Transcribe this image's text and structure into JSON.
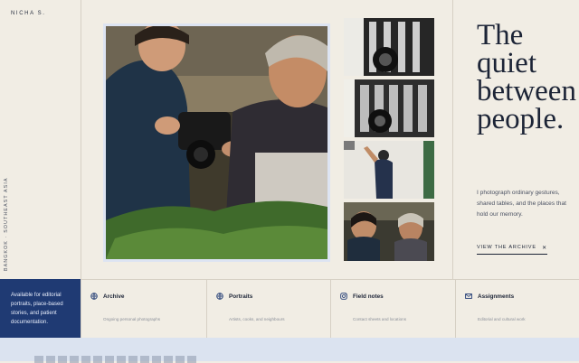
{
  "brand": "NICHA S.",
  "location_vertical": "BANGKOK · SOUTHEAST ASIA",
  "headline": [
    "The",
    "quiet",
    "between",
    "people."
  ],
  "intro": "I photograph ordinary gestures, shared tables, and the places that hold our memory.",
  "cta": {
    "label": "VIEW THE ARCHIVE",
    "icon": "x-icon"
  },
  "availability": "Available for editorial portraits, place-based stories, and patient documentation.",
  "cards": [
    {
      "title": "Archive",
      "desc": "Ongoing personal photographs",
      "icon": "globe-icon"
    },
    {
      "title": "Portraits",
      "desc": "Artists, cooks, and neighbours",
      "icon": "globe-icon"
    },
    {
      "title": "Field notes",
      "desc": "Contact sheets and locations",
      "icon": "instagram-icon"
    },
    {
      "title": "Assignments",
      "desc": "Editorial and cultural work",
      "icon": "mail-icon"
    }
  ],
  "colors": {
    "navy": "#1f3a73",
    "ink": "#1c2436",
    "paper": "#f1ede4",
    "pale_blue": "#dbe3f0"
  }
}
